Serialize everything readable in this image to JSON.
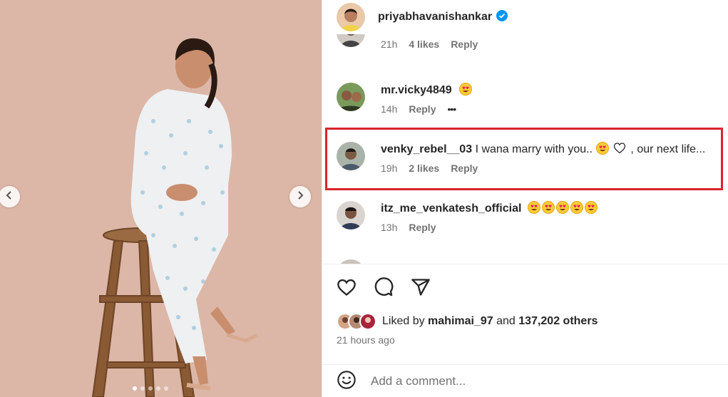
{
  "post": {
    "author": "priyabhavanishankar",
    "verified": true,
    "carousel": {
      "slides": 5,
      "active_index": 0
    }
  },
  "comments": [
    {
      "user": "",
      "text": "",
      "time": "21h",
      "likes": "4 likes",
      "reply": "Reply"
    },
    {
      "user": "mr.vicky4849",
      "text": "",
      "emojis": [
        "heart-eyes-emoji"
      ],
      "time": "14h",
      "likes": "",
      "reply": "Reply",
      "more": "•••"
    },
    {
      "user": "venky_rebel__03",
      "text": "I wana marry with you..",
      "text2": ", our next life...",
      "emojis": [
        "heart-eyes-emoji",
        "white-heart-emoji"
      ],
      "time": "19h",
      "likes": "2 likes",
      "reply": "Reply",
      "highlighted": true
    },
    {
      "user": "itz_me_venkatesh_official",
      "text": "",
      "emojis": [
        "heart-eyes-emoji",
        "heart-eyes-emoji",
        "heart-eyes-emoji",
        "heart-eyes-emoji",
        "heart-eyes-emoji"
      ],
      "time": "13h",
      "likes": "",
      "reply": "Reply"
    }
  ],
  "actions": {
    "icons": [
      "heart-icon",
      "comment-icon",
      "share-icon"
    ],
    "liked_by_prefix": "Liked by",
    "liked_by_user": "mahimai_97",
    "liked_by_and": "and",
    "liked_by_count": "137,202 others",
    "time_ago": "21 hours ago"
  },
  "add_comment": {
    "placeholder": "Add a comment..."
  },
  "colors": {
    "highlight": "#d9232e",
    "verified": "#0095f6",
    "background_photo": "#dcb7a7"
  }
}
